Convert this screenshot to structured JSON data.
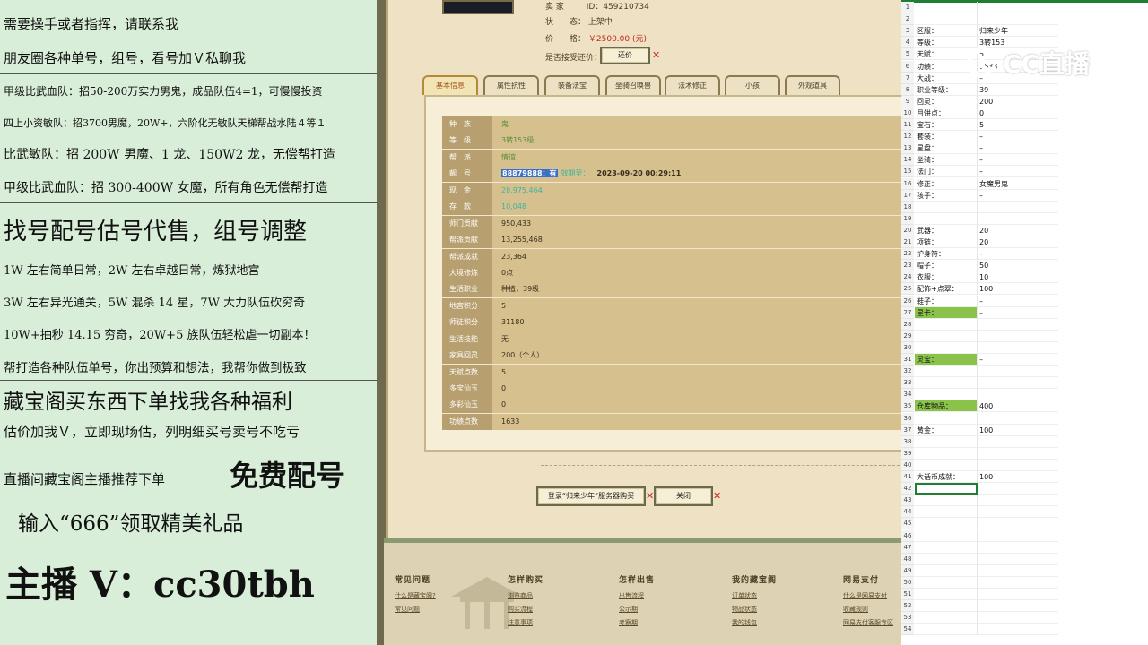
{
  "promo": {
    "line1": "需要操手或者指挥，请联系我",
    "line2": "朋友圈各种单号，组号，看号加Ｖ私聊我",
    "line3": "甲级比武血队：招50-200万实力男鬼，成品队伍4=1，可慢慢投资",
    "line4": "四上小资敏队：招3700男魔，20W+，六阶化无敏队天梯帮战水陆４等１",
    "line5": "比武敏队：招 200W 男魔、1 龙、150W2 龙，无偿帮打造",
    "line6": "甲级比武血队：招 300-400W 女魔，所有角色无偿帮打造",
    "line7": "找号配号估号代售，组号调整",
    "line8": "1W 左右简单日常，2W 左右卓越日常，炼狱地宫",
    "line9": "3W 左右异光通关，5W 混杀 14 星，7W 大力队伍砍穷奇",
    "line10": "10W+抽秒 14.15 穷奇，20W+5 族队伍轻松虐一切副本！",
    "line11": "帮打造各种队伍单号，你出预算和想法，我帮你做到极致",
    "line12": "藏宝阁买东西下单找我各种福利",
    "line13": "估价加我Ｖ，立即现场估，列明细买号卖号不吃亏",
    "line14a": "直播间藏宝阁主播推荐下单",
    "line14b": "免费配号",
    "line15": "输入“666”领取精美礼品",
    "line16": "主播 V：cc30tbh"
  },
  "game": {
    "seller_label": "卖 家",
    "seller_value": "ID：459210734",
    "status_label": "状　　态：",
    "status_value": "上架中",
    "price_label": "价　　格：",
    "price_value": "￥2500.00 (元)",
    "counter_label": "是否接受还价：",
    "counter_button": "还价",
    "tabs": [
      "基本信息",
      "属性抗性",
      "装备法宝",
      "坐骑召唤兽",
      "法术修正",
      "小孩",
      "外观道具"
    ],
    "rows": [
      {
        "k": "种　族",
        "v": "鬼"
      },
      {
        "k": "等　级",
        "v": "3转153级"
      },
      {
        "k": "帮　派",
        "v": "情谊"
      },
      {
        "k": "靓　号",
        "v": "88879888：有",
        "exp_label": "效期至：",
        "exp_date": "2023-09-20 00:29:11"
      },
      {
        "k": "现　金",
        "v": "28,975,464"
      },
      {
        "k": "存　款",
        "v": "10,048"
      },
      {
        "k": "师门贡献",
        "v": "950,433"
      },
      {
        "k": "帮派贡献",
        "v": "13,255,468"
      },
      {
        "k": "帮派成就",
        "v": "23,364"
      },
      {
        "k": "大境修炼",
        "v": "0点"
      },
      {
        "k": "生活职业",
        "v": "种植，39级"
      },
      {
        "k": "地宫积分",
        "v": "5"
      },
      {
        "k": "师徒积分",
        "v": "31180"
      },
      {
        "k": "生活技能",
        "v": "无"
      },
      {
        "k": "家具回灵",
        "v": "200（个人）"
      },
      {
        "k": "天赋点数",
        "v": "5"
      },
      {
        "k": "多宝仙玉",
        "v": "0"
      },
      {
        "k": "多彩仙玉",
        "v": "0"
      },
      {
        "k": "功绩点数",
        "v": "1633"
      }
    ],
    "login_button": "登录“归来少年”服务器购买",
    "close_button": "关闭",
    "footer": [
      {
        "title": "常见问题",
        "links": [
          "什么是藏宝阁?",
          "常见问题"
        ]
      },
      {
        "title": "怎样购买",
        "links": [
          "浏览商品",
          "购买流程",
          "注意事项"
        ]
      },
      {
        "title": "怎样出售",
        "links": [
          "出售流程",
          "公示期",
          "考察期"
        ]
      },
      {
        "title": "我的藏宝阁",
        "links": [
          "订单状态",
          "物品状态",
          "我的钱包"
        ]
      },
      {
        "title": "网易支付",
        "links": [
          "什么是网易支付",
          "收藏规则",
          "网易支付客服专区"
        ]
      }
    ]
  },
  "sheet": {
    "rows": [
      {
        "n": "1",
        "b": "",
        "c": ""
      },
      {
        "n": "2",
        "b": "",
        "c": ""
      },
      {
        "n": "3",
        "b": "区服：",
        "c": "归来少年"
      },
      {
        "n": "4",
        "b": "等级：",
        "c": "3转153"
      },
      {
        "n": "5",
        "b": "天赋：",
        "c": "5"
      },
      {
        "n": "6",
        "b": "功绩：",
        "c": "1633"
      },
      {
        "n": "7",
        "b": "大战：",
        "c": "–"
      },
      {
        "n": "8",
        "b": "职业等级：",
        "c": "39"
      },
      {
        "n": "9",
        "b": "回灵：",
        "c": "200"
      },
      {
        "n": "10",
        "b": "月饼点：",
        "c": "0"
      },
      {
        "n": "11",
        "b": "宝石：",
        "c": "5"
      },
      {
        "n": "12",
        "b": "套装：",
        "c": "–"
      },
      {
        "n": "13",
        "b": "星盘：",
        "c": "–"
      },
      {
        "n": "14",
        "b": "坐骑：",
        "c": "–"
      },
      {
        "n": "15",
        "b": "法门：",
        "c": "–"
      },
      {
        "n": "16",
        "b": "修正：",
        "c": "女魔男鬼"
      },
      {
        "n": "17",
        "b": "孩子：",
        "c": "–"
      },
      {
        "n": "18",
        "b": "",
        "c": ""
      },
      {
        "n": "19",
        "b": "",
        "c": ""
      },
      {
        "n": "20",
        "b": "武器：",
        "c": "20"
      },
      {
        "n": "21",
        "b": "项链：",
        "c": "20"
      },
      {
        "n": "22",
        "b": "护身符：",
        "c": "–"
      },
      {
        "n": "23",
        "b": "帽子：",
        "c": "50"
      },
      {
        "n": "24",
        "b": "衣服：",
        "c": "10"
      },
      {
        "n": "25",
        "b": "配饰+点翠：",
        "c": "100"
      },
      {
        "n": "26",
        "b": "鞋子：",
        "c": "–"
      },
      {
        "n": "27",
        "b": "星卡：",
        "c": "–",
        "green": true
      },
      {
        "n": "28",
        "b": "",
        "c": ""
      },
      {
        "n": "29",
        "b": "",
        "c": ""
      },
      {
        "n": "30",
        "b": "",
        "c": ""
      },
      {
        "n": "31",
        "b": "灵宝：",
        "c": "–",
        "green": true
      },
      {
        "n": "32",
        "b": "",
        "c": ""
      },
      {
        "n": "33",
        "b": "",
        "c": ""
      },
      {
        "n": "34",
        "b": "",
        "c": ""
      },
      {
        "n": "35",
        "b": "仓库物品：",
        "c": "400",
        "green": true
      },
      {
        "n": "36",
        "b": "",
        "c": ""
      },
      {
        "n": "37",
        "b": "黄金：",
        "c": "100"
      },
      {
        "n": "38",
        "b": "",
        "c": ""
      },
      {
        "n": "39",
        "b": "",
        "c": ""
      },
      {
        "n": "40",
        "b": "",
        "c": ""
      },
      {
        "n": "41",
        "b": "大话币成就：",
        "c": "100"
      },
      {
        "n": "42",
        "b": "",
        "c": "",
        "selected": true
      },
      {
        "n": "43",
        "b": "",
        "c": ""
      },
      {
        "n": "44",
        "b": "",
        "c": ""
      },
      {
        "n": "45",
        "b": "",
        "c": ""
      },
      {
        "n": "46",
        "b": "",
        "c": ""
      },
      {
        "n": "47",
        "b": "",
        "c": ""
      },
      {
        "n": "48",
        "b": "",
        "c": ""
      },
      {
        "n": "49",
        "b": "",
        "c": ""
      },
      {
        "n": "50",
        "b": "",
        "c": ""
      },
      {
        "n": "51",
        "b": "",
        "c": ""
      },
      {
        "n": "52",
        "b": "",
        "c": ""
      },
      {
        "n": "53",
        "b": "",
        "c": ""
      },
      {
        "n": "54",
        "b": "",
        "c": ""
      }
    ]
  },
  "watermark": {
    "text": "CC直播",
    "icon": "cc-live-logo-icon"
  },
  "colors": {
    "price": "#c0281c",
    "highlight": "#3a70c8",
    "teal": "#3ab4a0",
    "sheet_green": "#8bc34a"
  }
}
